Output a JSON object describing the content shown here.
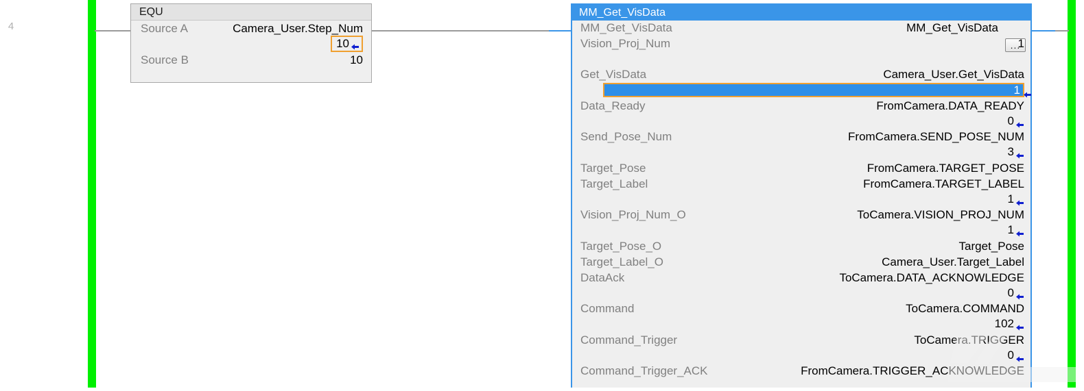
{
  "rung": {
    "number": "4"
  },
  "equ_block": {
    "title": "EQU",
    "rows": [
      {
        "label": "Source A",
        "operand": "Camera_User.Step_Num",
        "value": "10",
        "value_selected": true,
        "live": true
      },
      {
        "label": "Source B",
        "operand": "",
        "value": "10",
        "value_selected": false,
        "live": false
      }
    ]
  },
  "mm_block": {
    "title": "MM_Get_VisData",
    "ellipsis_button": "...",
    "rows": [
      {
        "label": "MM_Get_VisData",
        "operand": "MM_Get_VisData"
      },
      {
        "label": "Vision_Proj_Num",
        "operand": "1"
      },
      {
        "label": "Get_VisData",
        "operand": "Camera_User.Get_VisData"
      },
      {
        "label": "Data_Ready",
        "operand": "FromCamera.DATA_READY"
      },
      {
        "label": "Send_Pose_Num",
        "operand": "FromCamera.SEND_POSE_NUM"
      },
      {
        "label": "Target_Pose",
        "operand": "FromCamera.TARGET_POSE"
      },
      {
        "label": "Target_Label",
        "operand": "FromCamera.TARGET_LABEL"
      },
      {
        "label": "Vision_Proj_Num_O",
        "operand": "ToCamera.VISION_PROJ_NUM"
      },
      {
        "label": "Target_Pose_O",
        "operand": "Target_Pose"
      },
      {
        "label": "Target_Label_O",
        "operand": "Camera_User.Target_Label"
      },
      {
        "label": "DataAck",
        "operand": "ToCamera.DATA_ACKNOWLEDGE"
      },
      {
        "label": "Command",
        "operand": "ToCamera.COMMAND"
      },
      {
        "label": "Command_Trigger",
        "operand": "ToCamera.TRIGGER"
      },
      {
        "label": "Command_Trigger_ACK",
        "operand": "FromCamera.TRIGGER_ACKNOWLEDGE"
      }
    ],
    "values": [
      {
        "after": "Get_VisData",
        "value": "1",
        "selected": true,
        "live": true
      },
      {
        "after": "Data_Ready",
        "value": "0",
        "selected": false,
        "live": true
      },
      {
        "after": "Send_Pose_Num",
        "value": "3",
        "selected": false,
        "live": true
      },
      {
        "after": "Target_Label",
        "value": "1",
        "selected": false,
        "live": true
      },
      {
        "after": "Vision_Proj_Num_O",
        "value": "1",
        "selected": false,
        "live": true
      },
      {
        "after": "DataAck",
        "value": "0",
        "selected": false,
        "live": true
      },
      {
        "after": "Command",
        "value": "102",
        "selected": false,
        "live": true
      },
      {
        "after": "Command_Trigger",
        "value": "0",
        "selected": false,
        "live": true
      }
    ]
  },
  "colors": {
    "rail_green": "#00f000",
    "block_blue": "#3a95e8",
    "selection_orange": "#f0a030",
    "selection_fill": "#2e8fe8",
    "label_gray": "#808080",
    "block_background": "#efefef"
  }
}
